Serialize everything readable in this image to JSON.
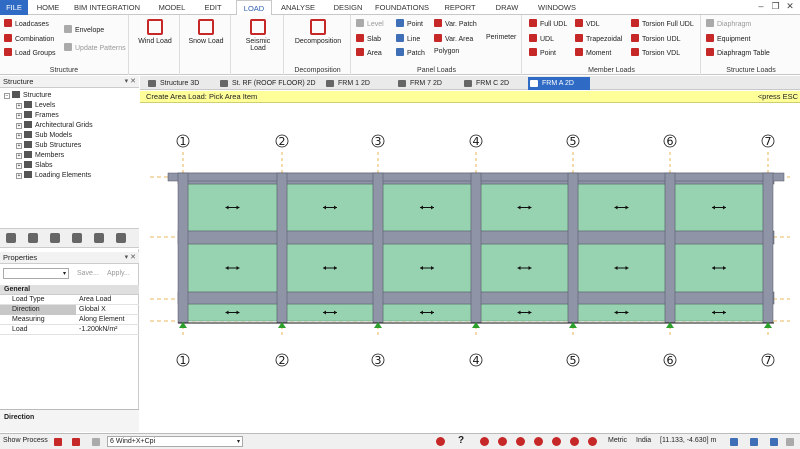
{
  "menu": {
    "items": [
      "FILE",
      "HOME",
      "BIM INTEGRATION",
      "MODEL",
      "EDIT",
      "LOAD",
      "ANALYSE",
      "DESIGN",
      "FOUNDATIONS",
      "REPORT",
      "DRAW",
      "WINDOWS"
    ],
    "active": "LOAD"
  },
  "ribbon": {
    "structure": {
      "label": "Structure",
      "loadcases": "Loadcases",
      "combination": "Combination",
      "load_groups": "Load Groups",
      "envelope": "Envelope",
      "update_patterns": "Update Patterns"
    },
    "wind": {
      "label": "Wind Load"
    },
    "snow": {
      "label": "Snow Load"
    },
    "seismic": {
      "label": "Seismic Load"
    },
    "decomposition": {
      "label": "Decomposition",
      "button": "Decomposition"
    },
    "panel": {
      "label": "Panel Loads",
      "level": "Level",
      "slab": "Slab",
      "area": "Area",
      "point": "Point",
      "line": "Line",
      "patch": "Patch",
      "var_patch": "Var. Patch",
      "var_area": "Var. Area",
      "polygon": "Polygon",
      "perimeter": "Perimeter"
    },
    "member": {
      "label": "Member Loads",
      "full_udl": "Full UDL",
      "udl": "UDL",
      "point": "Point",
      "vdl": "VDL",
      "trapezoidal": "Trapezoidal",
      "moment": "Moment",
      "torsion_full_udl": "Torsion Full UDL",
      "torsion_udl": "Torsion UDL",
      "torsion_vdl": "Torsion VDL"
    },
    "structure_loads": {
      "label": "Structure Loads",
      "diaphragm": "Diaphragm",
      "equipment": "Equipment",
      "diaphragm_table": "Diaphragm Table"
    }
  },
  "structure_panel": {
    "title": "Structure",
    "items": [
      "Structure",
      "Levels",
      "Frames",
      "Architectural Grids",
      "Sub Models",
      "Sub Structures",
      "Members",
      "Slabs",
      "Loading Elements"
    ]
  },
  "properties": {
    "title": "Properties",
    "save": "Save...",
    "apply": "Apply...",
    "section": "General",
    "rows": [
      {
        "key": "Load Type",
        "value": "Area Load"
      },
      {
        "key": "Direction",
        "value": "Global X"
      },
      {
        "key": "Measuring",
        "value": "Along Element"
      },
      {
        "key": "Load",
        "value": "-1.200kN/m²"
      }
    ],
    "description": "Direction"
  },
  "tabs": [
    "Structure 3D",
    "St. RF (ROOF FLOOR) 2D",
    "FRM 1 2D",
    "FRM 7 2D",
    "FRM C 2D",
    "FRM A 2D"
  ],
  "active_tab": "FRM A 2D",
  "prompt": {
    "text": "Create Area Load: Pick Area Item",
    "hint": "<press ESC"
  },
  "drawing": {
    "grid_labels": [
      "1",
      "2",
      "3",
      "4",
      "5",
      "6",
      "7"
    ],
    "bays": 6,
    "storeys": 3,
    "colors": {
      "panel": "#98d3b1",
      "beam": "#8f95a7",
      "grid": "#e5a328",
      "support": "#2ca02c"
    }
  },
  "statusbar": {
    "show_process": "Show Process",
    "loadcase": "6 Wind+X+Cpi",
    "units": "Metric",
    "code": "India",
    "coords": "[11.133, -4.630] m"
  }
}
